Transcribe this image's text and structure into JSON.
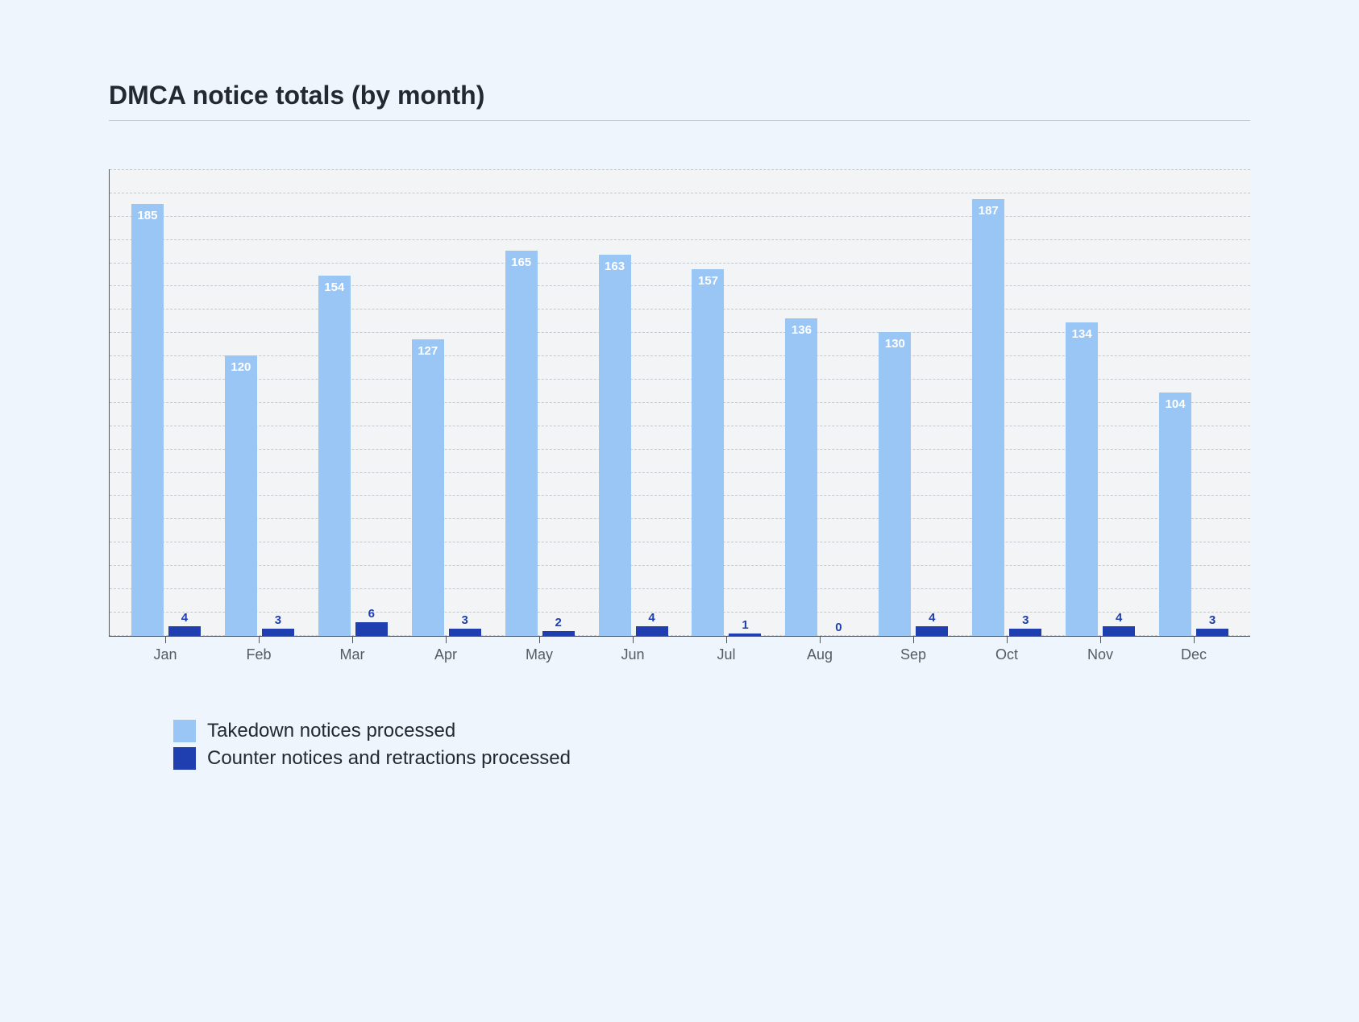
{
  "chart_data": {
    "type": "bar",
    "title": "DMCA notice totals (by month)",
    "categories": [
      "Jan",
      "Feb",
      "Mar",
      "Apr",
      "May",
      "Jun",
      "Jul",
      "Aug",
      "Sep",
      "Oct",
      "Nov",
      "Dec"
    ],
    "series": [
      {
        "name": "Takedown notices processed",
        "values": [
          185,
          120,
          154,
          127,
          165,
          163,
          157,
          136,
          130,
          187,
          134,
          104
        ],
        "color": "#9ac6f6"
      },
      {
        "name": "Counter notices and retractions processed",
        "values": [
          4,
          3,
          6,
          3,
          2,
          4,
          1,
          0,
          4,
          3,
          4,
          3
        ],
        "color": "#1f3fb0"
      }
    ],
    "xlabel": "",
    "ylabel": "",
    "ylim": [
      0,
      200
    ],
    "grid": true,
    "legend_position": "bottom"
  }
}
